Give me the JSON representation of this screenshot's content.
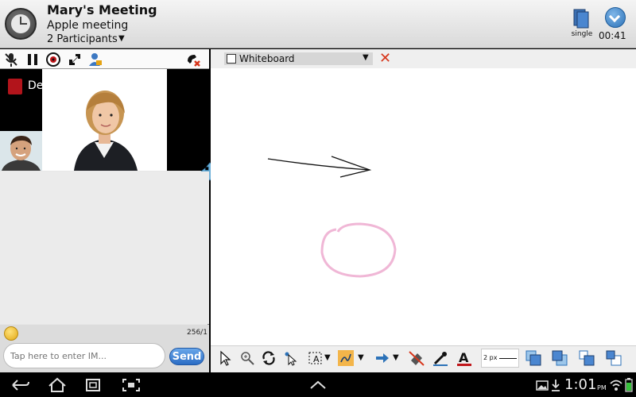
{
  "header": {
    "title": "Mary's Meeting",
    "subtitle": "Apple meeting",
    "participants": "2 Participants",
    "view_mode": "single",
    "elapsed": "00:41",
    "icons": [
      "clock-icon",
      "single-view-icon",
      "collapse-down-icon"
    ]
  },
  "media_toolbar": {
    "icons": [
      "mute-mic-icon",
      "pause-icon",
      "webcam-icon",
      "swap-video-icon",
      "participant-lock-icon",
      "hangup-icon"
    ]
  },
  "video": {
    "dial_tile_label": "De",
    "main_participant": "presenter-photo",
    "self_participant": "self-photo"
  },
  "chat": {
    "char_count": "256/1",
    "input_placeholder": "Tap here to enter IM...",
    "send_label": "Send"
  },
  "whiteboard": {
    "document_name": "Whiteboard",
    "stroke_width_label": "2 px",
    "tools": [
      "select-arrow-icon",
      "zoom-icon",
      "rotate-icon",
      "pointer-select-icon",
      "text-tool-icon",
      "pen-tool-icon",
      "arrow-shape-icon",
      "eraser-icon",
      "color-dropper-icon",
      "font-color-icon",
      "layer-front-icon",
      "layer-back-icon",
      "bring-forward-icon",
      "send-backward-icon"
    ],
    "drawing_colors": {
      "stroke": "#111111",
      "highlight": "#f0b7d6"
    }
  },
  "system_bar": {
    "time": "1:01",
    "ampm": "PM",
    "icons": [
      "back-icon",
      "home-icon",
      "recent-apps-icon",
      "screenshot-icon",
      "up-icon",
      "gallery-icon",
      "download-icon",
      "wifi-icon",
      "battery-icon"
    ]
  },
  "colors": {
    "accent_blue": "#2c72b8",
    "close_red": "#d7361b",
    "panel_gray": "#e7e7e7"
  }
}
